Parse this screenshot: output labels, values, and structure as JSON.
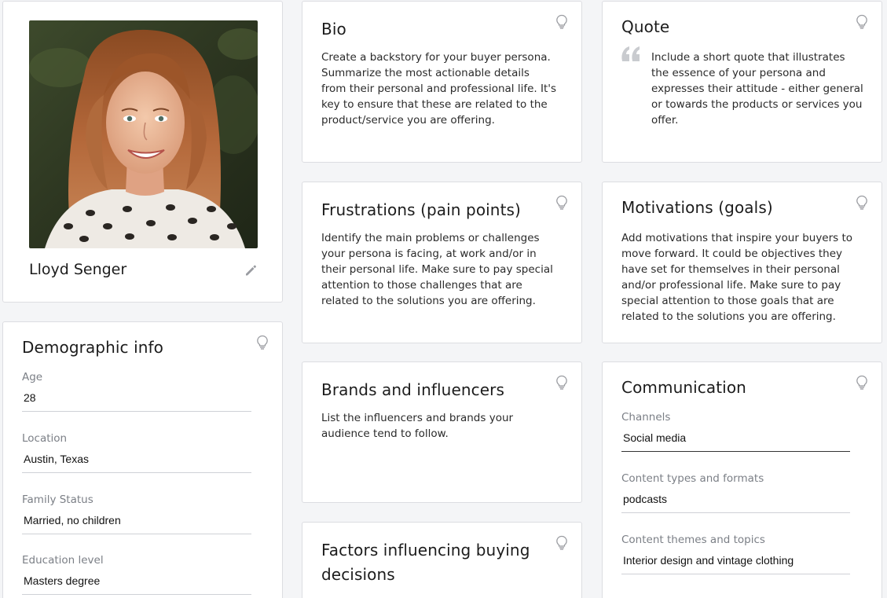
{
  "profile": {
    "name": "Lloyd Senger"
  },
  "demographic": {
    "title": "Demographic info",
    "fields": [
      {
        "label": "Age",
        "value": "28"
      },
      {
        "label": "Location",
        "value": "Austin, Texas"
      },
      {
        "label": "Family Status",
        "value": "Married, no children"
      },
      {
        "label": "Education level",
        "value": "Masters degree"
      }
    ]
  },
  "bio": {
    "title": "Bio",
    "text": "Create a backstory for your buyer persona. Summarize the most actionable details from their personal and professional life. It's key to ensure that these are related to the product/service you are offering."
  },
  "quote": {
    "title": "Quote",
    "text": "Include a short quote that illustrates the essence of your persona and expresses their attitude - either general or towards the products or services you offer."
  },
  "frustrations": {
    "title": "Frustrations (pain points)",
    "text": "Identify the main problems or challenges your persona is facing, at work and/or in their personal life. Make sure to pay special attention to those challenges that are related to the solutions you are offering."
  },
  "motivations": {
    "title": "Motivations (goals)",
    "text": "Add motivations that inspire your buyers to move forward. It could be objectives they have set for themselves in their personal and/or professional life. Make sure to pay special attention to those goals that are related to the solutions you are offering."
  },
  "brands": {
    "title": "Brands and influencers",
    "text": "List the influencers and brands your audience tend to follow."
  },
  "factors": {
    "title": "Factors influencing buying decisions"
  },
  "communication": {
    "title": "Communication",
    "fields": [
      {
        "label": "Channels",
        "value": "Social media"
      },
      {
        "label": "Content types and formats",
        "value": "podcasts"
      },
      {
        "label": "Content themes and topics",
        "value": "Interior design and vintage clothing"
      }
    ]
  },
  "icons": {
    "tip": "lightbulb-icon",
    "edit": "pencil-icon",
    "quote": "quotation-mark-icon"
  },
  "colors": {
    "background": "#f4f5f7",
    "card": "#ffffff",
    "border": "#dcdde1",
    "label": "#7b7f86",
    "icon": "#9a9ca1"
  }
}
